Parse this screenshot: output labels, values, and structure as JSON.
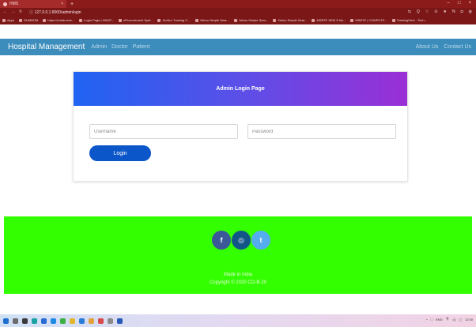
{
  "browser": {
    "tab_title": "HMS",
    "new_tab": "+",
    "address": "ⓘ 127.0.0.1:8000/adminlogin",
    "window_controls": [
      "–",
      "□",
      "×"
    ],
    "toolbar_right": [
      "⇆",
      "Q",
      "☆",
      "⊙",
      "★",
      "N",
      "◘",
      "◍"
    ],
    "bookmarks": [
      "Apps",
      "DUMBOM",
      "https://colab.rese...",
      "Login Page | HDMT...",
      "eProcurement Syst...",
      "Jio/Aur Training C...",
      "Yahoo Simple Sear...",
      "Yahoo Simple Sear...",
      "Yahoo Simple Sear...",
      "MSBTE SEM 3 Mo...",
      "MSBTE | COMPUTE...",
      "TrainingView - Tech..."
    ]
  },
  "navbar": {
    "brand": "Hospital Management",
    "links": [
      "Admin",
      "Doctor",
      "Patient"
    ],
    "right_links": [
      "About Us",
      "Contact Us"
    ]
  },
  "login": {
    "header": "Admin Login Page",
    "username_placeholder": "Username",
    "password_placeholder": "Password",
    "button_label": "Login"
  },
  "footer": {
    "socials": [
      "f",
      "◎",
      "t"
    ],
    "made_in": "Made in India",
    "copyright": "Copyright © 2020 CO-B-20"
  },
  "taskbar": {
    "tray": [
      "^",
      "□",
      "ENG",
      "令",
      "◁)",
      "▢"
    ],
    "clock": "12:30"
  },
  "colors": {
    "chrome": "#8b1a1a",
    "navbar": "#3c8dbc",
    "gradient_start": "#1f63f2",
    "gradient_end": "#9a2fd6",
    "button": "#0b56c8",
    "footer": "#33ff00"
  }
}
